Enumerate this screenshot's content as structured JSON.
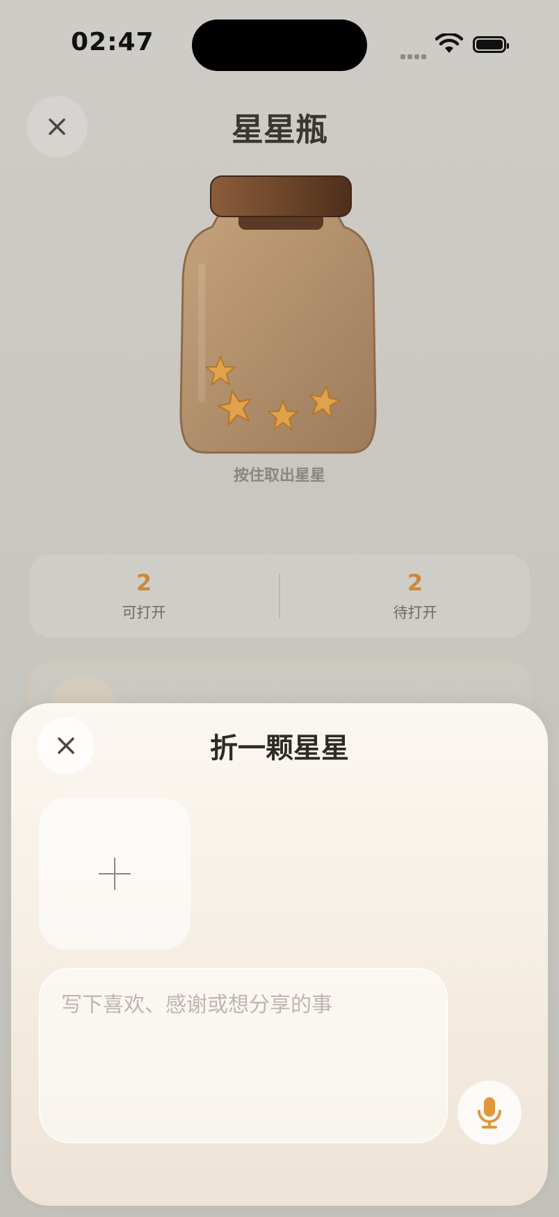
{
  "status_bar": {
    "time": "02:47"
  },
  "header": {
    "title": "星星瓶"
  },
  "jar": {
    "hint": "按住取出星星"
  },
  "stats": [
    {
      "value": "2",
      "label": "可打开"
    },
    {
      "value": "2",
      "label": "待打开"
    }
  ],
  "sheet": {
    "title": "折一颗星星",
    "note_placeholder": "写下喜欢、感谢或想分享的事"
  },
  "colors": {
    "accent": "#c88a3a",
    "star": "#e0a24a",
    "jar_lid": "#6b4429"
  }
}
